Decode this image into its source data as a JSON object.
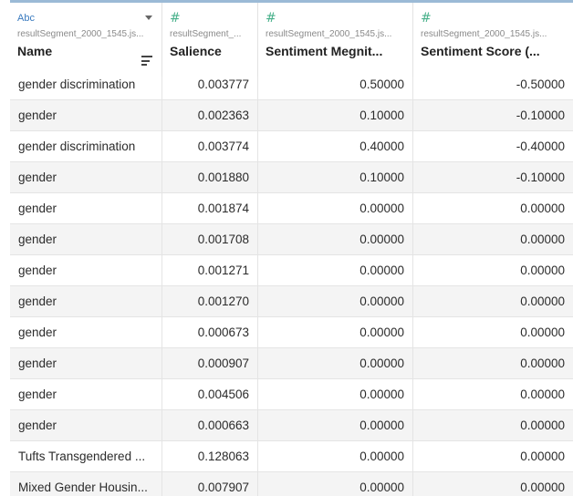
{
  "columns": [
    {
      "type_label": "Abc",
      "source": "resultSegment_2000_1545.js...",
      "name": "Name"
    },
    {
      "type_label": "#",
      "source": "resultSegment_...",
      "name": "Salience"
    },
    {
      "type_label": "#",
      "source": "resultSegment_2000_1545.js...",
      "name": "Sentiment Megnit..."
    },
    {
      "type_label": "#",
      "source": "resultSegment_2000_1545.js...",
      "name": "Sentiment Score (..."
    }
  ],
  "rows": [
    [
      "gender discrimination",
      "0.003777",
      "0.50000",
      "-0.50000"
    ],
    [
      "gender",
      "0.002363",
      "0.10000",
      "-0.10000"
    ],
    [
      "gender discrimination",
      "0.003774",
      "0.40000",
      "-0.40000"
    ],
    [
      "gender",
      "0.001880",
      "0.10000",
      "-0.10000"
    ],
    [
      "gender",
      "0.001874",
      "0.00000",
      "0.00000"
    ],
    [
      "gender",
      "0.001708",
      "0.00000",
      "0.00000"
    ],
    [
      "gender",
      "0.001271",
      "0.00000",
      "0.00000"
    ],
    [
      "gender",
      "0.001270",
      "0.00000",
      "0.00000"
    ],
    [
      "gender",
      "0.000673",
      "0.00000",
      "0.00000"
    ],
    [
      "gender",
      "0.000907",
      "0.00000",
      "0.00000"
    ],
    [
      "gender",
      "0.004506",
      "0.00000",
      "0.00000"
    ],
    [
      "gender",
      "0.000663",
      "0.00000",
      "0.00000"
    ],
    [
      "Tufts Transgendered ...",
      "0.128063",
      "0.00000",
      "0.00000"
    ],
    [
      "Mixed Gender Housin...",
      "0.007907",
      "0.00000",
      "0.00000"
    ]
  ],
  "icons": {
    "type_dropdown": "chevron-down-icon",
    "sort": "sort-icon"
  },
  "colors": {
    "string_type": "#3b7bbf",
    "number_type": "#49b18b",
    "header_top_border": "#9bbad6"
  }
}
